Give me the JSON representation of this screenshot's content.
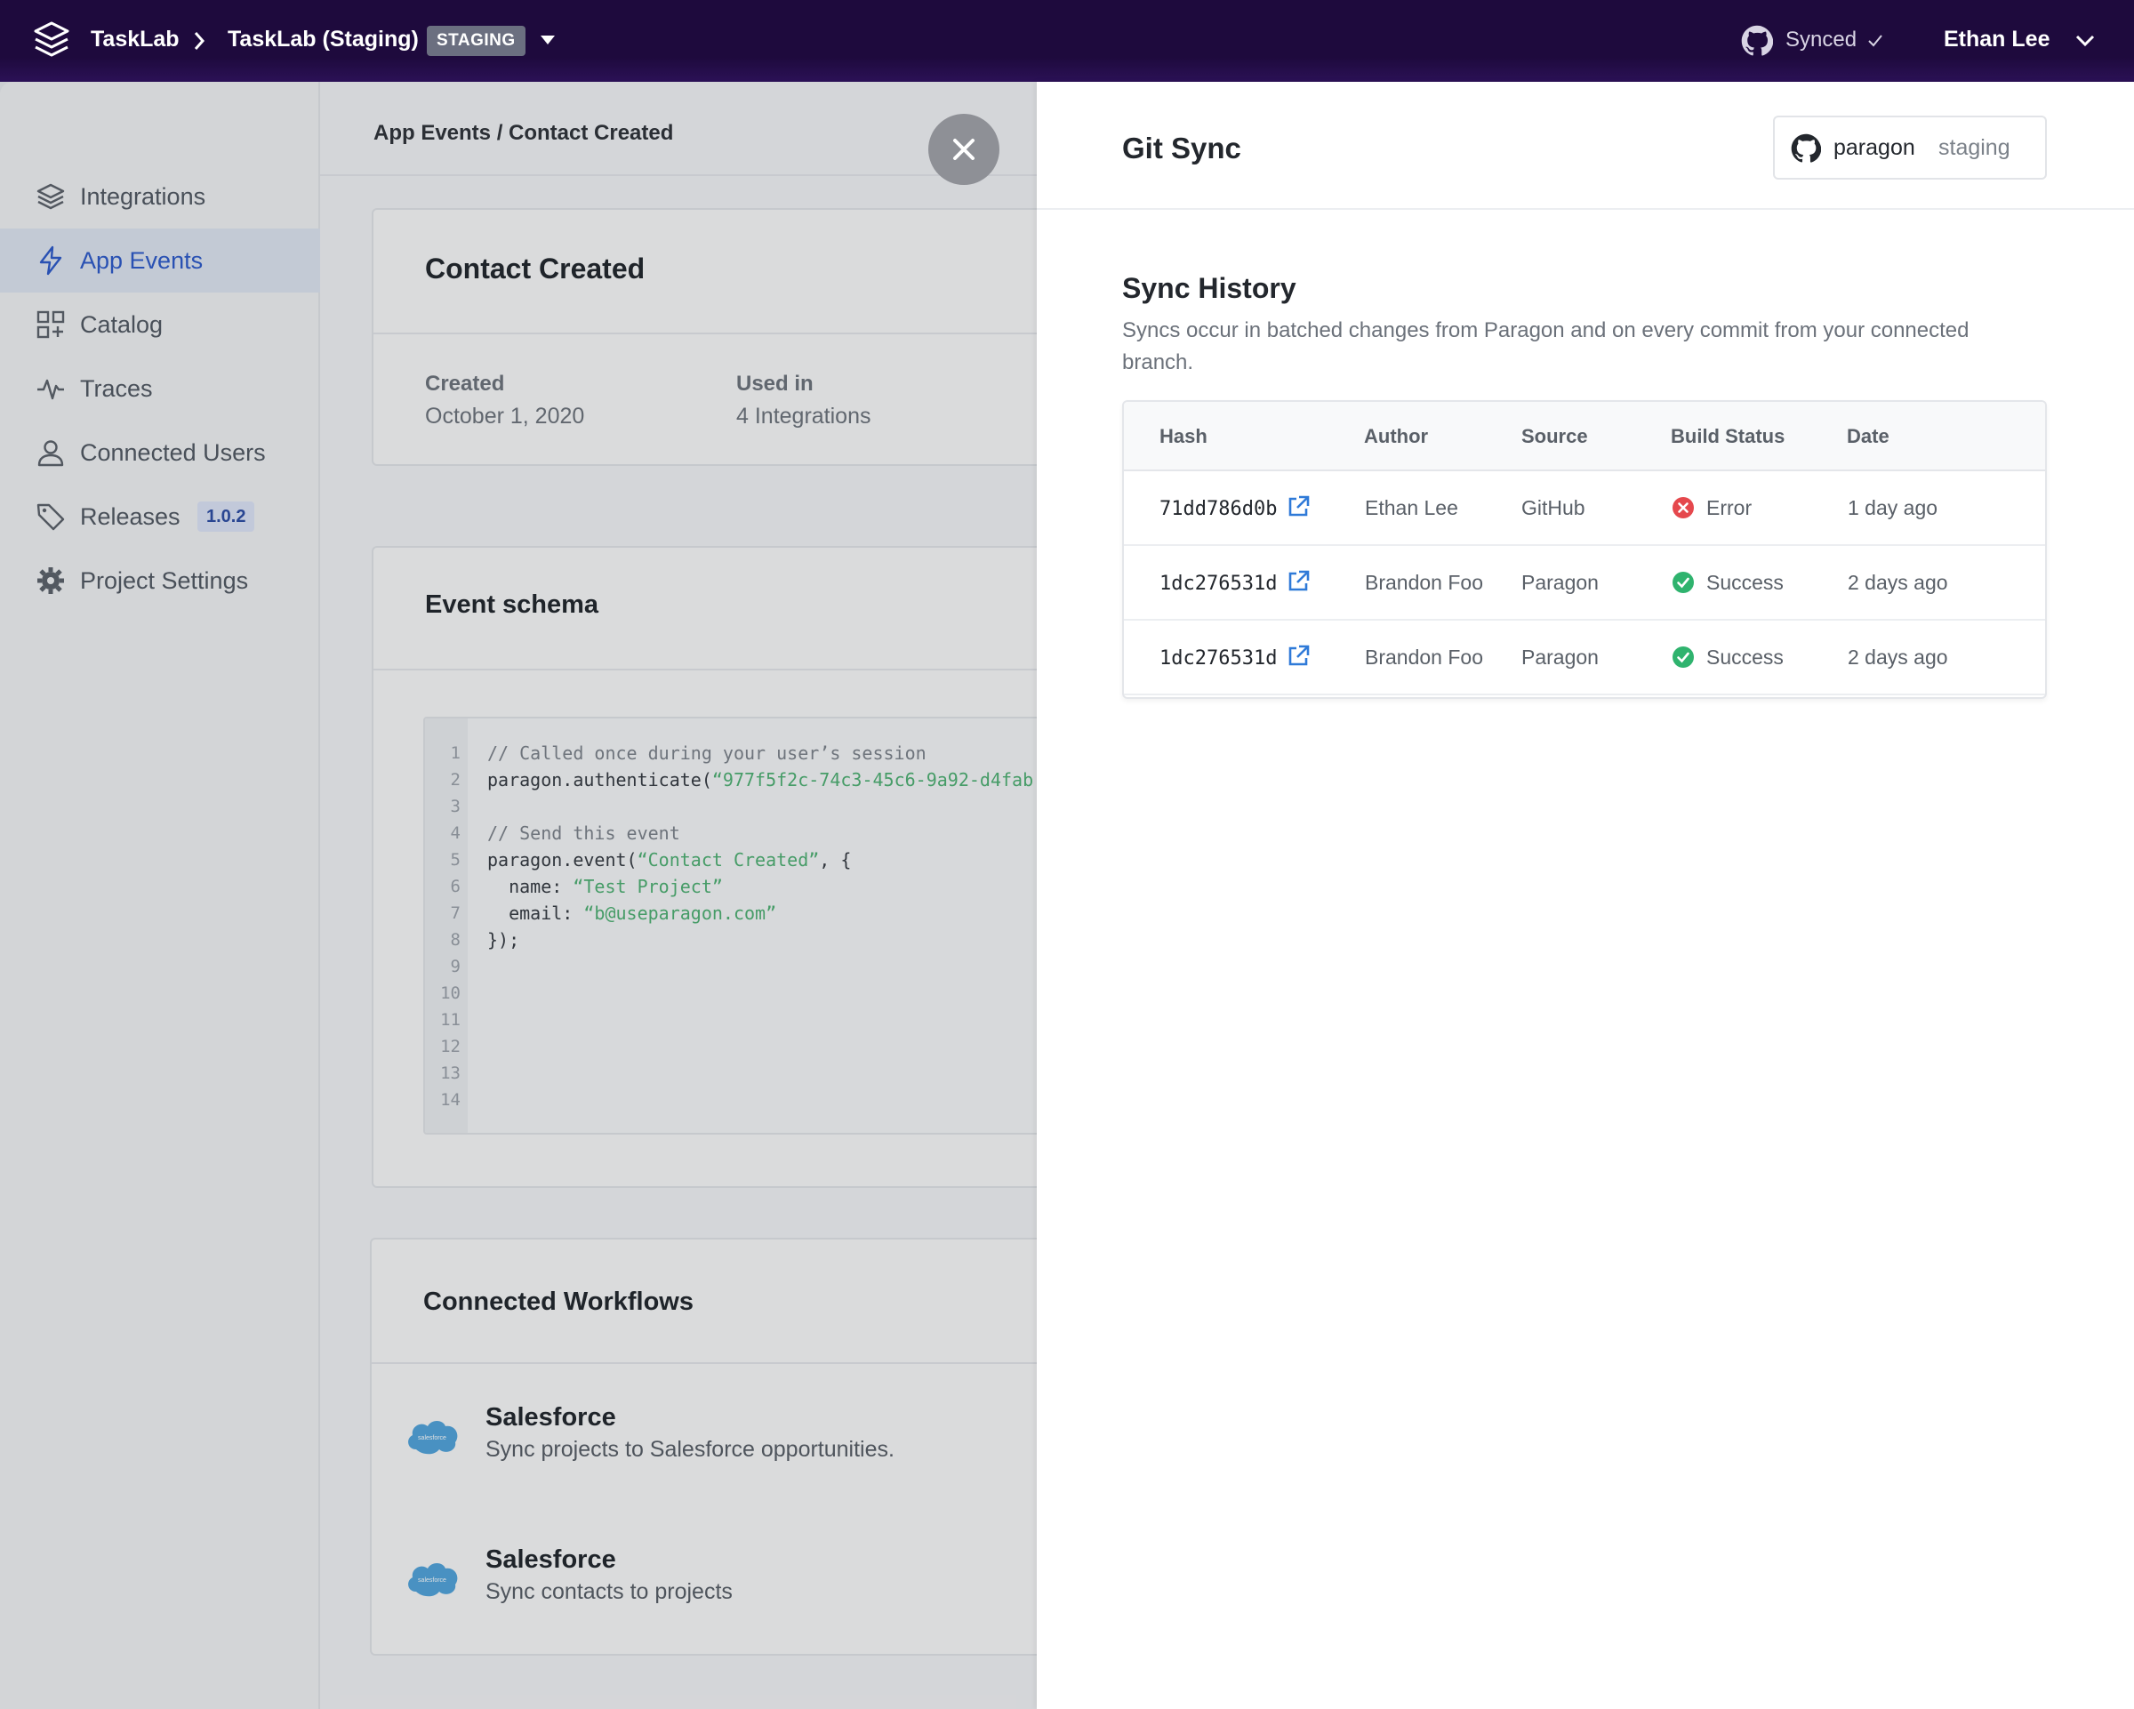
{
  "topbar": {
    "app_name": "TaskLab",
    "project_name": "TaskLab (Staging)",
    "env_badge": "STAGING",
    "sync_status": "Synced",
    "user_name": "Ethan Lee"
  },
  "sidebar": {
    "items": [
      {
        "label": "Integrations",
        "icon": "layers-icon"
      },
      {
        "label": "App Events",
        "icon": "lightning-icon",
        "active": true
      },
      {
        "label": "Catalog",
        "icon": "grid-plus-icon"
      },
      {
        "label": "Traces",
        "icon": "pulse-icon"
      },
      {
        "label": "Connected Users",
        "icon": "user-icon"
      },
      {
        "label": "Releases",
        "icon": "tag-icon",
        "badge": "1.0.2"
      },
      {
        "label": "Project Settings",
        "icon": "gear-icon"
      }
    ]
  },
  "main": {
    "breadcrumb": "App Events / Contact Created",
    "event": {
      "title": "Contact Created",
      "created_label": "Created",
      "created_value": "October 1, 2020",
      "used_label": "Used in",
      "used_value": "4 Integrations"
    },
    "schema": {
      "title": "Event schema",
      "line_numbers": [
        "1",
        "2",
        "3",
        "4",
        "5",
        "6",
        "7",
        "8",
        "9",
        "10",
        "11",
        "12",
        "13",
        "14"
      ],
      "lines": [
        {
          "a": "// Called once during your user’s session",
          "b": "",
          "c": ""
        },
        {
          "a": "paragon.authenticate(",
          "b": "“977f5f2c-74c3-45c6-9a92-d4fab",
          "c": ""
        },
        {
          "a": "",
          "b": "",
          "c": ""
        },
        {
          "a": "// Send this event",
          "b": "",
          "c": ""
        },
        {
          "a": "paragon.event(",
          "b": "“Contact Created”",
          "c": ", {"
        },
        {
          "a": "  name: ",
          "b": "“Test Project”",
          "c": ""
        },
        {
          "a": "  email: ",
          "b": "“b@useparagon.com”",
          "c": ""
        },
        {
          "a": "});",
          "b": "",
          "c": ""
        }
      ]
    },
    "workflows": {
      "title": "Connected Workflows",
      "logo_text": "salesforce",
      "items": [
        {
          "title": "Salesforce",
          "desc": "Sync projects to Salesforce opportunities."
        },
        {
          "title": "Salesforce",
          "desc": "Sync contacts to projects"
        }
      ]
    }
  },
  "drawer": {
    "title": "Git Sync",
    "repo_name": "paragon",
    "repo_branch": "staging",
    "history_title": "Sync History",
    "history_desc": "Syncs occur in batched changes from Paragon and on every commit from your connected branch.",
    "columns": [
      "Hash",
      "Author",
      "Source",
      "Build Status",
      "Date"
    ],
    "rows": [
      {
        "hash": "71dd786d0b",
        "author": "Ethan Lee",
        "source": "GitHub",
        "status": "Error",
        "date": "1 day ago"
      },
      {
        "hash": "1dc276531d",
        "author": "Brandon Foo",
        "source": "Paragon",
        "status": "Success",
        "date": "2 days ago"
      },
      {
        "hash": "1dc276531d",
        "author": "Brandon Foo",
        "source": "Paragon",
        "status": "Success",
        "date": "2 days ago"
      }
    ]
  },
  "colors": {
    "topbar": "#1e0a3d",
    "accent": "#2a57c9",
    "error": "#e5484d",
    "success": "#2fb36e",
    "link": "#2f7ad8"
  }
}
